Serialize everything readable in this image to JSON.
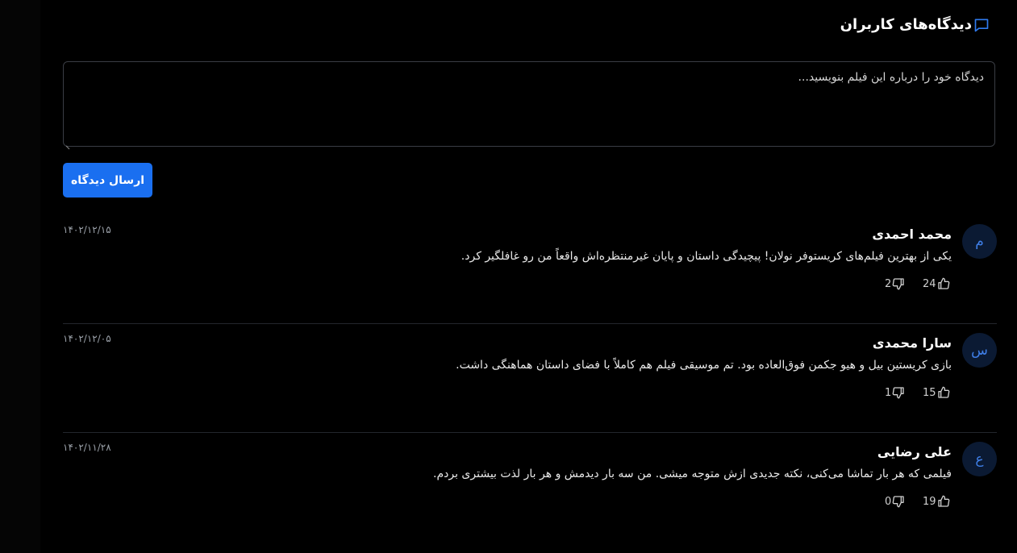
{
  "header": {
    "title": "دیدگاه‌های کاربران",
    "icon": "comment-icon"
  },
  "form": {
    "placeholder": "دیدگاه خود را درباره این فیلم بنویسید...",
    "submit_label": "ارسال دیدگاه"
  },
  "colors": {
    "accent": "#1a6ff0",
    "background": "#000000"
  },
  "comments": [
    {
      "avatar": "م",
      "name": "محمد احمدی",
      "text": "یکی از بهترین فیلم‌های کریستوفر نولان! پیچیدگی داستان و پایان غیرمنتظره‌اش واقعاً من رو غافلگیر کرد.",
      "date": "۱۴۰۲/۱۲/۱۵",
      "likes": "24",
      "dislikes": "2"
    },
    {
      "avatar": "س",
      "name": "سارا محمدی",
      "text": "بازی کریستین بیل و هیو جکمن فوق‌العاده بود. تم موسیقی فیلم هم کاملاً با فضای داستان هماهنگی داشت.",
      "date": "۱۴۰۲/۱۲/۰۵",
      "likes": "15",
      "dislikes": "1"
    },
    {
      "avatar": "ع",
      "name": "علی رضایی",
      "text": "فیلمی که هر بار تماشا می‌کنی، نکته جدیدی ازش متوجه میشی. من سه بار دیدمش و هر بار لذت بیشتری بردم.",
      "date": "۱۴۰۲/۱۱/۲۸",
      "likes": "19",
      "dislikes": "0"
    }
  ]
}
